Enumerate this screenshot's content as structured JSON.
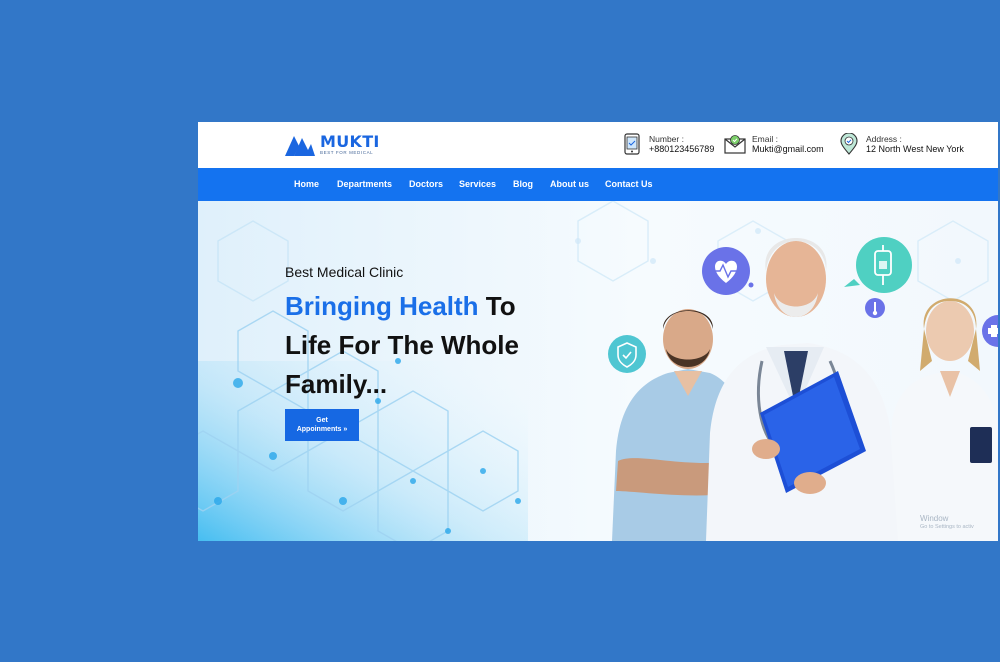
{
  "logo": {
    "name": "MUKTI",
    "tagline": "BEST FOR MEDICAL"
  },
  "contacts": {
    "number": {
      "label": "Number :",
      "value": "+880123456789",
      "icon": "phone-icon"
    },
    "email": {
      "label": "Email :",
      "value": "Mukti@gmail.com",
      "icon": "mail-icon"
    },
    "address": {
      "label": "Address :",
      "value": "12 North West New York",
      "icon": "location-pin-icon"
    }
  },
  "nav": [
    "Home",
    "Departments",
    "Doctors",
    "Services",
    "Blog",
    "About us",
    "Contact Us"
  ],
  "hero": {
    "subtitle": "Best Medical Clinic",
    "title_highlight": "Bringing Health",
    "title_rest_1": " To",
    "title_rest_2": "Life For The Whole",
    "title_rest_3": "Family...",
    "cta_line1": "Get",
    "cta_line2": "Appoinments »"
  },
  "watermark": {
    "line1": "Window",
    "line2": "Go to Settings to activ"
  },
  "colors": {
    "brand": "#1473f0",
    "background": "#3277c8",
    "accent_text": "#1a6fe8",
    "badge": "#4fc6d2"
  }
}
